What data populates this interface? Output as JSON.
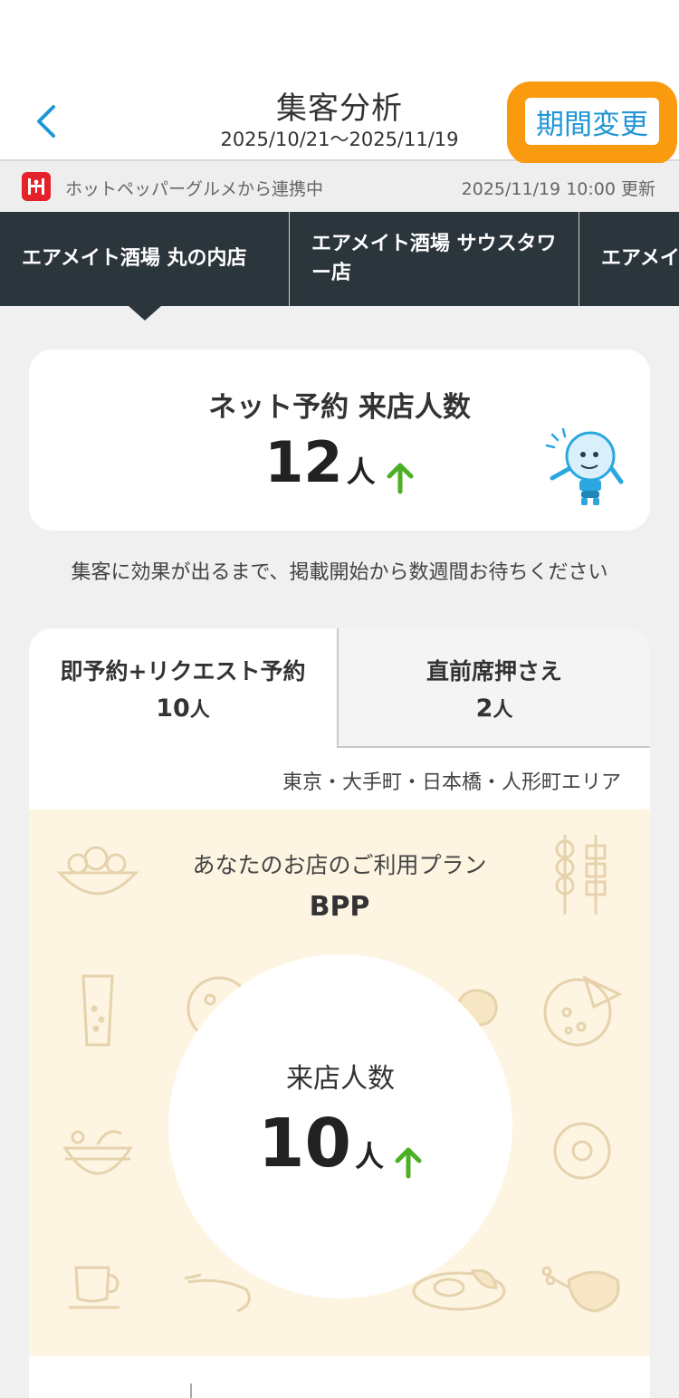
{
  "header": {
    "title": "集客分析",
    "date_range": "2025/10/21〜2025/11/19",
    "period_button": "期間変更"
  },
  "sync": {
    "logo_char": "H",
    "text": "ホットペッパーグルメから連携中",
    "updated": "2025/11/19 10:00 更新"
  },
  "stores": [
    {
      "label": "エアメイト酒場 丸の内店"
    },
    {
      "label": "エアメイト酒場 サウスタワー店"
    },
    {
      "label": "エアメイ"
    }
  ],
  "summary": {
    "title": "ネット予約 来店人数",
    "value": "12",
    "unit": "人",
    "trend": "up"
  },
  "note": "集客に効果が出るまで、掲載開始から数週間お待ちください",
  "tabs": [
    {
      "label": "即予約+リクエスト予約",
      "value": "10",
      "unit": "人",
      "active": true
    },
    {
      "label": "直前席押さえ",
      "value": "2",
      "unit": "人",
      "active": false
    }
  ],
  "area": "東京・大手町・日本橋・人形町エリア",
  "plan": {
    "label": "あなたのお店のご利用プラン",
    "name": "BPP"
  },
  "visits": {
    "label": "来店人数",
    "value": "10",
    "unit": "人",
    "trend": "up"
  },
  "colors": {
    "accent_blue": "#2196d6",
    "highlight_orange": "#f99a0f",
    "store_bar": "#2b353c",
    "up_arrow": "#4caf24",
    "plan_bg": "#fdf4e2",
    "hp_red": "#e5212a"
  }
}
